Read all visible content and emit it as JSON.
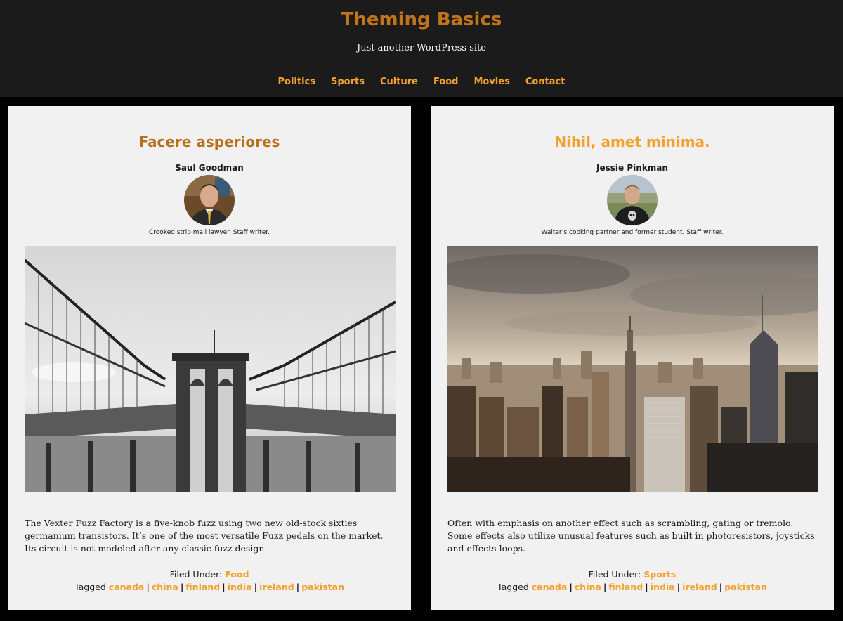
{
  "site": {
    "title": "Theming Basics",
    "tagline": "Just another WordPress site",
    "accent": "#f5a030",
    "title_color": "#c0751b"
  },
  "nav": {
    "items": [
      {
        "label": "Politics"
      },
      {
        "label": "Sports"
      },
      {
        "label": "Culture"
      },
      {
        "label": "Food"
      },
      {
        "label": "Movies"
      },
      {
        "label": "Contact"
      }
    ]
  },
  "posts": [
    {
      "title": "Facere asperiores",
      "author": "Saul Goodman",
      "bio": "Crooked strip mall lawyer. Staff writer.",
      "excerpt": "The Vexter Fuzz Factory is a five-knob fuzz using two new old-stock sixties germanium transistors. It’s one of the most versatile Fuzz pedals on the market. Its circuit is not modeled after any classic fuzz design",
      "filed_label": "Filed Under:",
      "category": "Food",
      "tagged_label": "Tagged",
      "tags": [
        "canada",
        "china",
        "finland",
        "india",
        "ireland",
        "pakistan"
      ]
    },
    {
      "title": "Nihil, amet minima.",
      "author": "Jessie Pinkman",
      "bio": "Walter’s cooking partner and former student. Staff writer.",
      "excerpt": "Often with emphasis on another effect such as scrambling, gating or tremolo. Some effects also utilize unusual features such as built in photoresistors, joysticks and effects loops.",
      "filed_label": "Filed Under:",
      "category": "Sports",
      "tagged_label": "Tagged",
      "tags": [
        "canada",
        "china",
        "finland",
        "india",
        "ireland",
        "pakistan"
      ]
    }
  ],
  "separator": "|"
}
